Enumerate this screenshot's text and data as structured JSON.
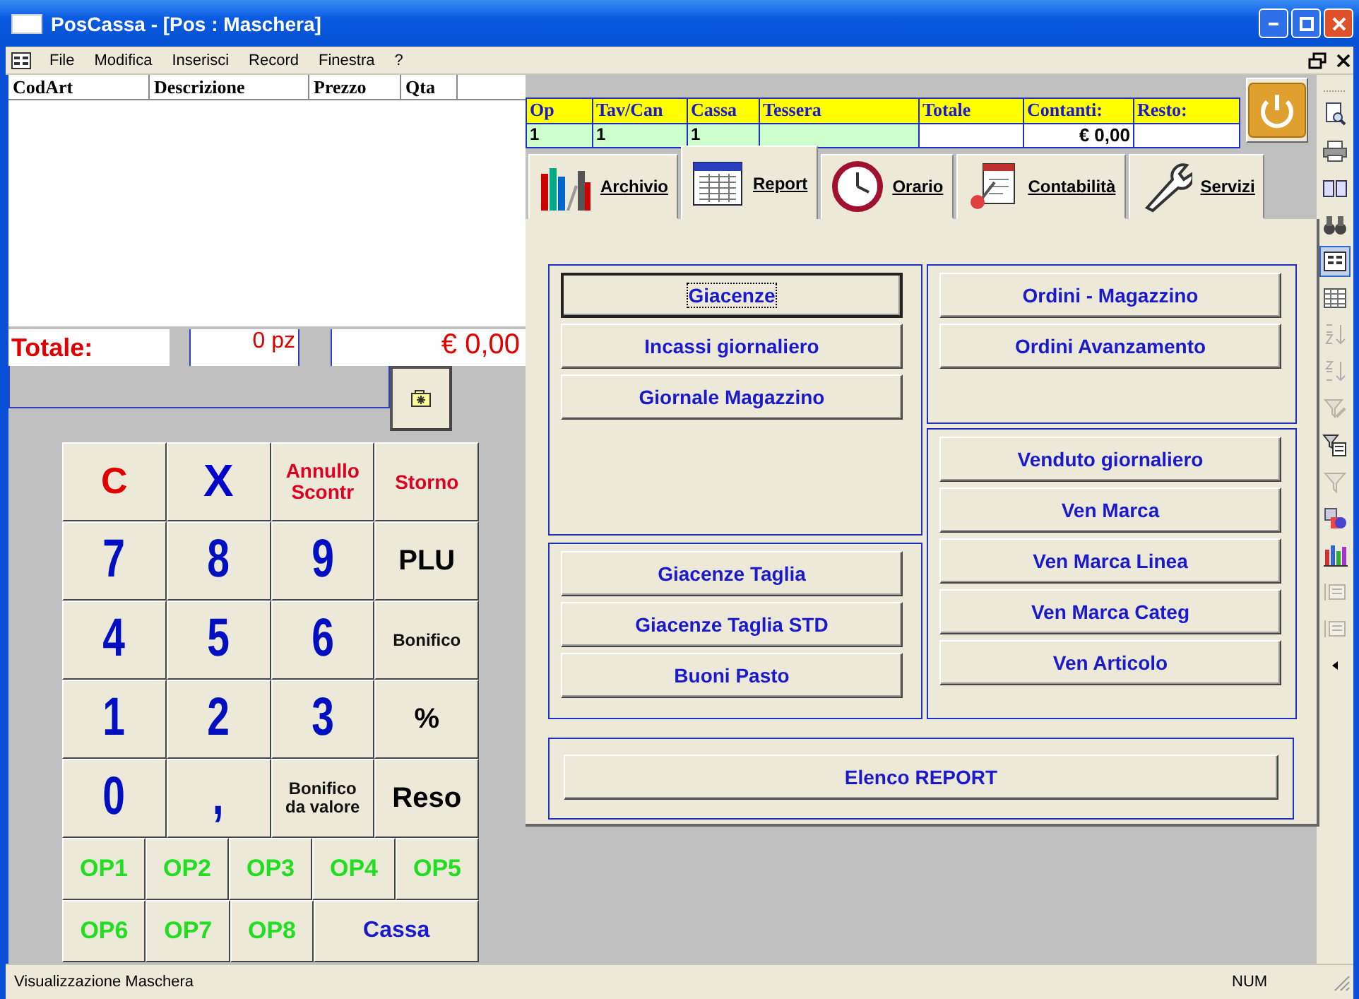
{
  "window": {
    "title": "PosCassa - [Pos : Maschera]"
  },
  "menu": [
    "File",
    "Modifica",
    "Inserisci",
    "Record",
    "Finestra",
    "?"
  ],
  "item_list": {
    "columns": [
      "CodArt",
      "Descrizione",
      "Prezzo",
      "Qta"
    ]
  },
  "totals": {
    "label": "Totale:",
    "pieces": "0 pz",
    "amount": "€ 0,00"
  },
  "keypad": {
    "rows": [
      {
        "keys": [
          {
            "label": "C",
            "kind": "clear"
          },
          {
            "label": "X",
            "kind": "mult"
          },
          {
            "label": "Annullo\nScontr",
            "kind": "void"
          },
          {
            "label": "Storno",
            "kind": "void"
          }
        ]
      },
      {
        "keys": [
          {
            "label": "7",
            "kind": "digit"
          },
          {
            "label": "8",
            "kind": "digit"
          },
          {
            "label": "9",
            "kind": "digit"
          },
          {
            "label": "PLU",
            "kind": "plu"
          }
        ]
      },
      {
        "keys": [
          {
            "label": "4",
            "kind": "digit"
          },
          {
            "label": "5",
            "kind": "digit"
          },
          {
            "label": "6",
            "kind": "digit"
          },
          {
            "label": "Bonifico",
            "kind": "note"
          }
        ]
      },
      {
        "keys": [
          {
            "label": "1",
            "kind": "digit"
          },
          {
            "label": "2",
            "kind": "digit"
          },
          {
            "label": "3",
            "kind": "digit"
          },
          {
            "label": "%",
            "kind": "plu"
          }
        ]
      },
      {
        "keys": [
          {
            "label": "0",
            "kind": "digit"
          },
          {
            "label": ",",
            "kind": "digit"
          },
          {
            "label": "Bonifico\nda valore",
            "kind": "note"
          },
          {
            "label": "Reso",
            "kind": "plu"
          }
        ]
      },
      {
        "keys": [
          {
            "label": "OP1",
            "kind": "op"
          },
          {
            "label": "OP2",
            "kind": "op"
          },
          {
            "label": "OP3",
            "kind": "op"
          },
          {
            "label": "OP4",
            "kind": "op"
          },
          {
            "label": "OP5",
            "kind": "op"
          }
        ]
      },
      {
        "keys": [
          {
            "label": "OP6",
            "kind": "op"
          },
          {
            "label": "OP7",
            "kind": "op"
          },
          {
            "label": "OP8",
            "kind": "op"
          },
          {
            "label": "Cassa",
            "kind": "till"
          }
        ]
      }
    ]
  },
  "sale": {
    "columns": [
      {
        "header": "Op",
        "value": "1",
        "kind": "session"
      },
      {
        "header": "Tav/Can",
        "value": "1",
        "kind": "session"
      },
      {
        "header": "Cassa",
        "value": "1",
        "kind": "session"
      },
      {
        "header": "Tessera",
        "kind": "session"
      },
      {
        "header": "Totale",
        "kind": "amount"
      },
      {
        "header": "Contanti:",
        "value": "€ 0,00",
        "kind": "amount"
      },
      {
        "header": "Resto:",
        "kind": "amount"
      }
    ]
  },
  "tabs": [
    {
      "label": "Archivio",
      "kind": "books",
      "selected": false
    },
    {
      "label": "Report",
      "kind": "grid",
      "selected": true
    },
    {
      "label": "Orario",
      "kind": "clock",
      "selected": false
    },
    {
      "label": "Contabilità",
      "kind": "notes",
      "selected": false
    },
    {
      "label": "Servizi",
      "kind": "wrench",
      "selected": false
    }
  ],
  "report_groups": [
    {
      "buttons": [
        {
          "label": "Giacenze",
          "focused": true
        },
        {
          "label": "Incassi giornaliero",
          "focused": false
        },
        {
          "label": "Giornale Magazzino",
          "focused": false
        }
      ]
    },
    {
      "buttons": [
        {
          "label": "Ordini - Magazzino",
          "focused": false
        },
        {
          "label": "Ordini Avanzamento",
          "focused": false
        }
      ]
    },
    {
      "buttons": [
        {
          "label": "Venduto giornaliero",
          "focused": false
        },
        {
          "label": "Ven Marca",
          "focused": false
        },
        {
          "label": "Ven Marca Linea",
          "focused": false
        },
        {
          "label": "Ven Marca Categ",
          "focused": false
        },
        {
          "label": "Ven Articolo",
          "focused": false
        }
      ]
    },
    {
      "buttons": [
        {
          "label": "Giacenze Taglia",
          "focused": false
        },
        {
          "label": "Giacenze Taglia STD",
          "focused": false
        },
        {
          "label": "Buoni Pasto",
          "focused": false
        }
      ]
    },
    {
      "buttons": [
        {
          "label": "Elenco REPORT",
          "focused": false
        }
      ]
    }
  ],
  "toolbar": [
    {
      "kind": "preview",
      "selected": false,
      "disabled": false
    },
    {
      "kind": "print",
      "selected": false,
      "disabled": false
    },
    {
      "kind": "book",
      "selected": false,
      "disabled": false
    },
    {
      "kind": "binoculars",
      "selected": false,
      "disabled": false
    },
    {
      "kind": "form",
      "selected": true,
      "disabled": false
    },
    {
      "kind": "table",
      "selected": false,
      "disabled": false
    },
    {
      "kind": "sortaz",
      "selected": false,
      "disabled": true
    },
    {
      "kind": "sortza",
      "selected": false,
      "disabled": true
    },
    {
      "kind": "filter",
      "selected": false,
      "disabled": true
    },
    {
      "kind": "formfilter",
      "selected": false,
      "disabled": false
    },
    {
      "kind": "funnel",
      "selected": false,
      "disabled": true
    },
    {
      "kind": "shapes",
      "selected": false,
      "disabled": false
    },
    {
      "kind": "bars",
      "selected": false,
      "disabled": false
    },
    {
      "kind": "list",
      "selected": false,
      "disabled": true
    },
    {
      "kind": "list",
      "selected": false,
      "disabled": true
    },
    {
      "kind": "more",
      "selected": false,
      "disabled": false
    }
  ],
  "status_bar": {
    "message": "Visualizzazione Maschera",
    "indicator": "NUM"
  }
}
